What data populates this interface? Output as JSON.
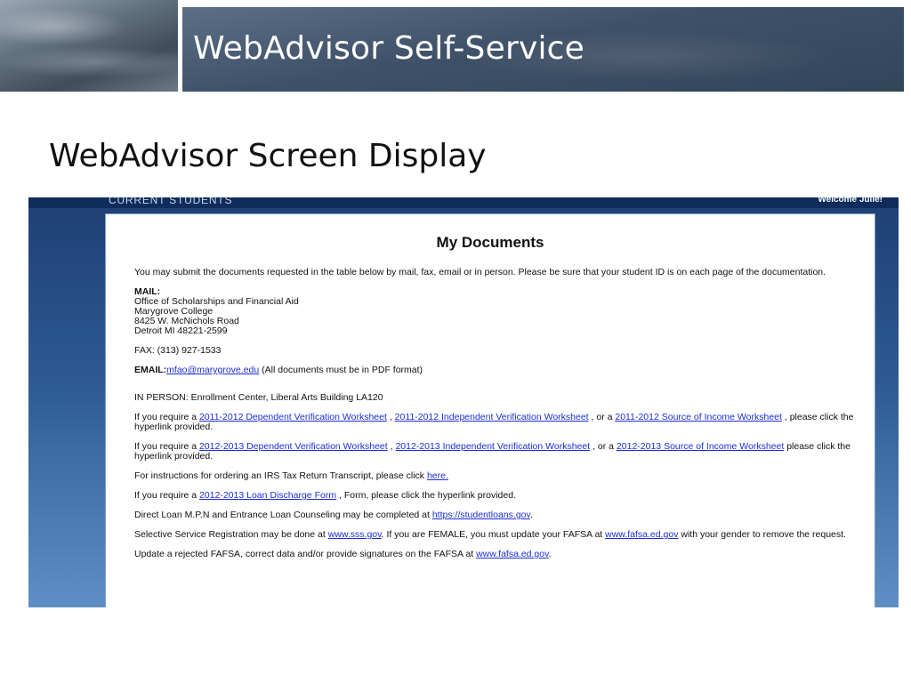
{
  "slide": {
    "title": "WebAdvisor Self-Service",
    "heading": "WebAdvisor Screen Display"
  },
  "webadvisor": {
    "section_title": "Current Students",
    "welcome": "Welcome Julie!",
    "page_title": "My Documents",
    "intro": "You may submit the documents requested in the table below by mail, fax, email or in person. Please be sure that your student ID is on each page of the documentation.",
    "mail": {
      "label": "MAIL:",
      "line1": "Office of Scholarships and Financial Aid",
      "line2": "Marygrove College",
      "line3": "8425 W. McNichols Road",
      "line4": "Detroit MI 48221-2599"
    },
    "fax": "FAX: (313) 927-1533",
    "email": {
      "label": "EMAIL:",
      "address": "mfao@marygrove.edu",
      "note": "(All documents must be in PDF format)"
    },
    "in_person": "IN PERSON: Enrollment Center, Liberal Arts Building LA120",
    "req2011": {
      "prefix": "If you require a",
      "link1": "2011-2012 Dependent Verification Worksheet",
      "sep1": ",",
      "link2": "2011-2012 Independent Verification Worksheet",
      "sep2": ", or a",
      "link3": "2011-2012 Source of Income Worksheet",
      "suffix": ", please click the hyperlink provided."
    },
    "req2012": {
      "prefix": "If you require a",
      "link1": "2012-2013 Dependent Verification Worksheet",
      "sep1": ",",
      "link2": "2012-2013 Independent Verification Worksheet",
      "sep2": ", or a",
      "link3": "2012-2013 Source of Income Worksheet",
      "suffix": "please click the hyperlink provided."
    },
    "irs": {
      "text": "For instructions for ordering an IRS Tax Return Transcript, please click",
      "link": "here."
    },
    "loan_discharge": {
      "prefix": "If you require a",
      "link": "2012-2013 Loan Discharge Form",
      "suffix": ", Form, please click the hyperlink provided."
    },
    "direct_loan": {
      "text": "Direct Loan M.P.N and Entrance Loan Counseling may be completed at",
      "link": "https://studentloans.gov",
      "suffix": "."
    },
    "selective": {
      "text": "Selective Service Registration may be done at",
      "link1": "www.sss.gov",
      "middle": ". If you are FEMALE, you must update your FAFSA at",
      "link2": "www.fafsa.ed.gov",
      "suffix": "with your gender to remove the request."
    },
    "fafsa_update": {
      "text": "Update a rejected FAFSA, correct data and/or provide signatures on the FAFSA at",
      "link": "www.fafsa.ed.gov",
      "suffix": "."
    }
  }
}
